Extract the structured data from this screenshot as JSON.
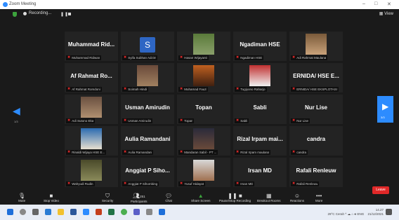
{
  "window": {
    "title": "Zoom Meeting"
  },
  "topbar": {
    "recording_label": "Recording...",
    "view_label": "View"
  },
  "grid": {
    "tiles": [
      {
        "name": "Muhammad Rid...",
        "caption": "Muhammad Ridwan"
      },
      {
        "avatar_letter": "S",
        "caption": "Syifa Subhan Adzim"
      },
      {
        "caption": "Hasan Wijayanti"
      },
      {
        "name": "Ngadiman HSE",
        "caption": "Ngadiman HSE"
      },
      {
        "caption": "Adi Rahmat Maulana"
      },
      {
        "name": "Af Rahmat Ro...",
        "caption": "Af Rahmat Romdoni"
      },
      {
        "caption": "Soimah Hindi"
      },
      {
        "caption": "Muhamad Fauzi"
      },
      {
        "caption": "Tugiyono Raharjo"
      },
      {
        "name": "ERNIDA/ HSE E...",
        "caption": "ERNIDA/ HSE EKSPLOTASI"
      },
      {
        "caption": "Adi Sutono Eka"
      },
      {
        "name": "Usman Amirudin",
        "caption": "Usman Amirudin"
      },
      {
        "name": "Topan",
        "caption": "Topan"
      },
      {
        "name": "Sabli",
        "caption": "Sabli"
      },
      {
        "name": "Nur Lise",
        "caption": "Nur Lise"
      },
      {
        "caption": "Rinaldi Wijaya HSE E..."
      },
      {
        "name": "Aulia Ramandani",
        "caption": "Aulia Ramandani"
      },
      {
        "caption": "Mandaran Sabil - PT ..."
      },
      {
        "name": "Rizal Irpam mai...",
        "caption": "Rizal Irpam maulana"
      },
      {
        "name": "candra",
        "caption": "candra"
      },
      {
        "caption": "Wahyudi Rudin"
      },
      {
        "name": "Anggiat P Siho...",
        "caption": "Anggiat P Sihombing"
      },
      {
        "caption": "Yusuf Hidayat"
      },
      {
        "name": "Irsan MD",
        "caption": "Irsan MD"
      },
      {
        "name": "Rafali Renleuw",
        "caption": "Rafali Renleuw"
      }
    ]
  },
  "nav": {
    "left_page": "1/3",
    "right_page": "3/3"
  },
  "toolbar": {
    "mute": "Mute",
    "video": "Stop Video",
    "security": "Security",
    "participants": "Participants",
    "participants_count": "251",
    "chat": "Chat",
    "share": "Share Screen",
    "pause_rec": "Pause/Stop Recording",
    "breakout": "Breakout Rooms",
    "reactions": "Reactions",
    "more": "More",
    "leave": "Leave"
  },
  "tray": {
    "weather": "29°C Cerah",
    "time": "14.27",
    "date": "21/12/2021"
  },
  "colors": {
    "accent": "#2d8cff",
    "danger": "#e02828",
    "bg": "#1a1a1a",
    "tile": "#232323"
  }
}
